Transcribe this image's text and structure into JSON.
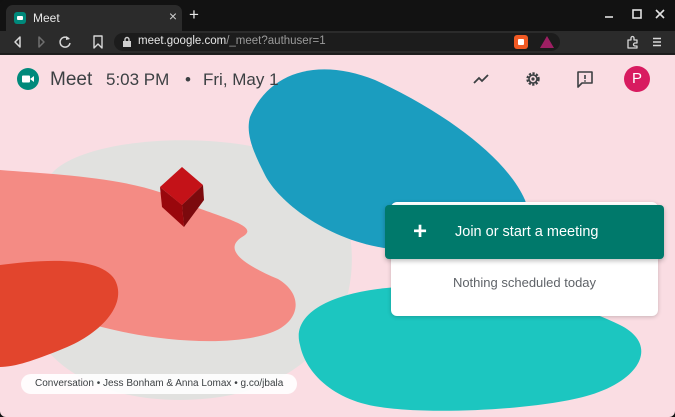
{
  "browser": {
    "tab_title": "Meet",
    "tab_close": "×",
    "new_tab": "+",
    "url_host": "meet.google.com",
    "url_path": "/_meet?authuser=1",
    "icons": [
      "back-icon",
      "forward-icon",
      "reload-icon",
      "bookmark-icon",
      "lock-icon",
      "brave-shield-icon",
      "brave-rewards-icon",
      "extensions-icon",
      "menu-icon",
      "minimize-icon",
      "maximize-icon",
      "close-icon"
    ]
  },
  "header": {
    "app_name": "Meet",
    "time": "5:03 PM",
    "separator": "•",
    "date": "Fri, May 1",
    "avatar_initial": "P",
    "icons": [
      "meet-logo-icon",
      "trend-icon",
      "gear-icon",
      "feedback-icon"
    ]
  },
  "main": {
    "join_plus": "+",
    "join_label": "Join or start a meeting",
    "schedule_status": "Nothing scheduled today"
  },
  "credit": {
    "conversation": "Conversation",
    "dot1": "•",
    "artists": "Jess Bonham & Anna Lomax",
    "dot2": "•",
    "link": "g.co/jbala"
  },
  "colors": {
    "brand_teal": "#00796b",
    "avatar": "#d81b60",
    "page_bg": "#fadde3"
  }
}
